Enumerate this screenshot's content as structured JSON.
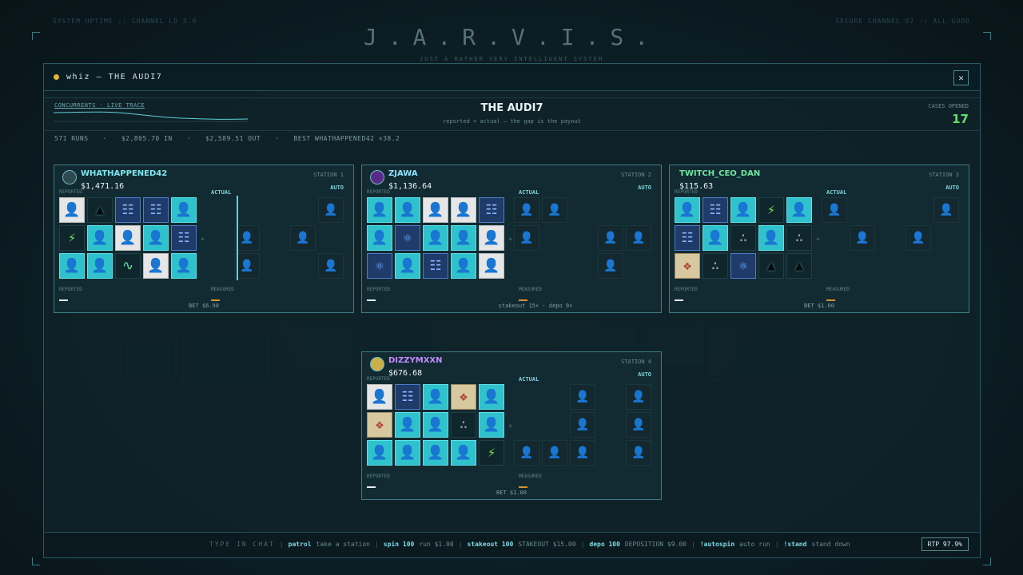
{
  "backdrop": {
    "left_text": "SYSTEM UPTIME :: CHANNEL LD 3.0",
    "right_text": "SECURE CHANNEL 07 :: ALL GOOD",
    "logo": "J.A.R.V.I.S.",
    "tagline": "JUST A RATHER VERY INTELLIGENT SYSTEM"
  },
  "window": {
    "title": "whiz — THE AUDI7",
    "close_label": "✕"
  },
  "header": {
    "concurrents_label": "CONCURRENTS · LIVE TRACE",
    "title": "THE AUDI7",
    "subtitle": "reported + actual — the gap is the payout",
    "cases_label": "CASES OPENED",
    "cases_value": "17"
  },
  "stats": {
    "runs": "571 RUNS",
    "sep": "·",
    "in": "$2,805.70 IN",
    "out": "$2,589.51 OUT",
    "best": "BEST WHATHAPPENED42 ×38.2"
  },
  "labels": {
    "reported": "REPORTED",
    "actual": "ACTUAL",
    "measured": "MEASURED",
    "auto": "AUTO"
  },
  "icons": {
    "person": "person-icon",
    "silhouette": "silhouette-icon",
    "document": "document-icon",
    "bolt": "bolt-icon",
    "pulse": "pulse-icon",
    "atom": "atom-icon",
    "map": "map-icon",
    "shards": "shards-icon",
    "ghost": "ghost-person-icon"
  },
  "stations": [
    {
      "name": "WHATHAPPENED42",
      "name_color": "#7fe7ef",
      "balance": "$1,471.16",
      "station": "STATION 1",
      "footer": "BET $6.90",
      "left": [
        "rev:person",
        "dark:silhouette",
        "blue:document",
        "blue:document",
        "hl:person",
        "dark:bolt",
        "hl:person",
        "rev:person",
        "hl:person",
        "blue:document",
        "hl:person",
        "hl:person",
        "dark:pulse",
        "rev:person",
        "hl:person"
      ],
      "right": [
        "empty",
        "empty",
        "empty",
        "empty",
        "ghost:person",
        "empty",
        "ghost:person",
        "empty",
        "ghost:person",
        "empty",
        "empty",
        "ghost:person",
        "empty",
        "empty",
        "ghost:person"
      ]
    },
    {
      "name": "ZJAWA",
      "name_color": "#8ee4ff",
      "balance": "$1,136.64",
      "station": "STATION 2",
      "footer": "stakeout 15× · depo 9×",
      "left": [
        "hl:person",
        "hl:person",
        "rev:person",
        "rev:person",
        "blue:document",
        "hl:person",
        "blue:atom",
        "hl:person",
        "hl:person",
        "rev:person",
        "blue:atom",
        "hl:person",
        "blue:document",
        "hl:person",
        "rev:person"
      ],
      "right": [
        "ghost:person",
        "ghost:person",
        "empty",
        "empty",
        "empty",
        "ghost:person",
        "empty",
        "empty",
        "ghost:person",
        "ghost:person",
        "empty",
        "empty",
        "empty",
        "ghost:person",
        "empty"
      ]
    },
    {
      "name": "TWITCH_CEO_DAN",
      "name_color": "#6ee6a0",
      "balance": "$115.63",
      "station": "STATION 3",
      "footer": "BET $1.00",
      "left": [
        "hl:person",
        "blue:document",
        "hl:person",
        "dark:bolt",
        "hl:person",
        "blue:document",
        "hl:person",
        "dark:shards",
        "hl:person",
        "dark:shards",
        "map:map",
        "dark:shards",
        "blue:atom",
        "dark:silhouette",
        "dark:silhouette"
      ],
      "right": [
        "ghost:person",
        "empty",
        "empty",
        "empty",
        "ghost:person",
        "empty",
        "ghost:person",
        "empty",
        "ghost:person",
        "empty",
        "empty",
        "empty",
        "empty",
        "empty",
        "empty"
      ]
    },
    {
      "name": "DIZZYMXXN",
      "name_color": "#c48cff",
      "balance": "$676.68",
      "station": "STATION 4",
      "footer": "BET $1.00",
      "left": [
        "rev:person",
        "blue:document",
        "hl:person",
        "map:map",
        "hl:person",
        "map:map",
        "hl:person",
        "hl:person",
        "dark:shards",
        "hl:person",
        "hl:person",
        "hl:person",
        "hl:person",
        "hl:person",
        "dark:bolt"
      ],
      "right": [
        "empty",
        "empty",
        "ghost:person",
        "empty",
        "ghost:person",
        "empty",
        "empty",
        "ghost:person",
        "empty",
        "ghost:person",
        "ghost:person",
        "ghost:person",
        "ghost:person",
        "empty",
        "ghost:person"
      ]
    }
  ],
  "commands": [
    {
      "key": "TYPE IN CHAT",
      "desc": ""
    },
    {
      "key": "patrol",
      "desc": "take a station"
    },
    {
      "key": "spin 100",
      "desc": "run $1.00"
    },
    {
      "key": "stakeout 100",
      "desc": "STAKEOUT $15.00"
    },
    {
      "key": "depo 100",
      "desc": "DEPOSITION $9.00"
    },
    {
      "key": "!autospin",
      "desc": "auto run"
    },
    {
      "key": "!stand",
      "desc": "stand down"
    }
  ],
  "rtp": "RTP 97.9%"
}
